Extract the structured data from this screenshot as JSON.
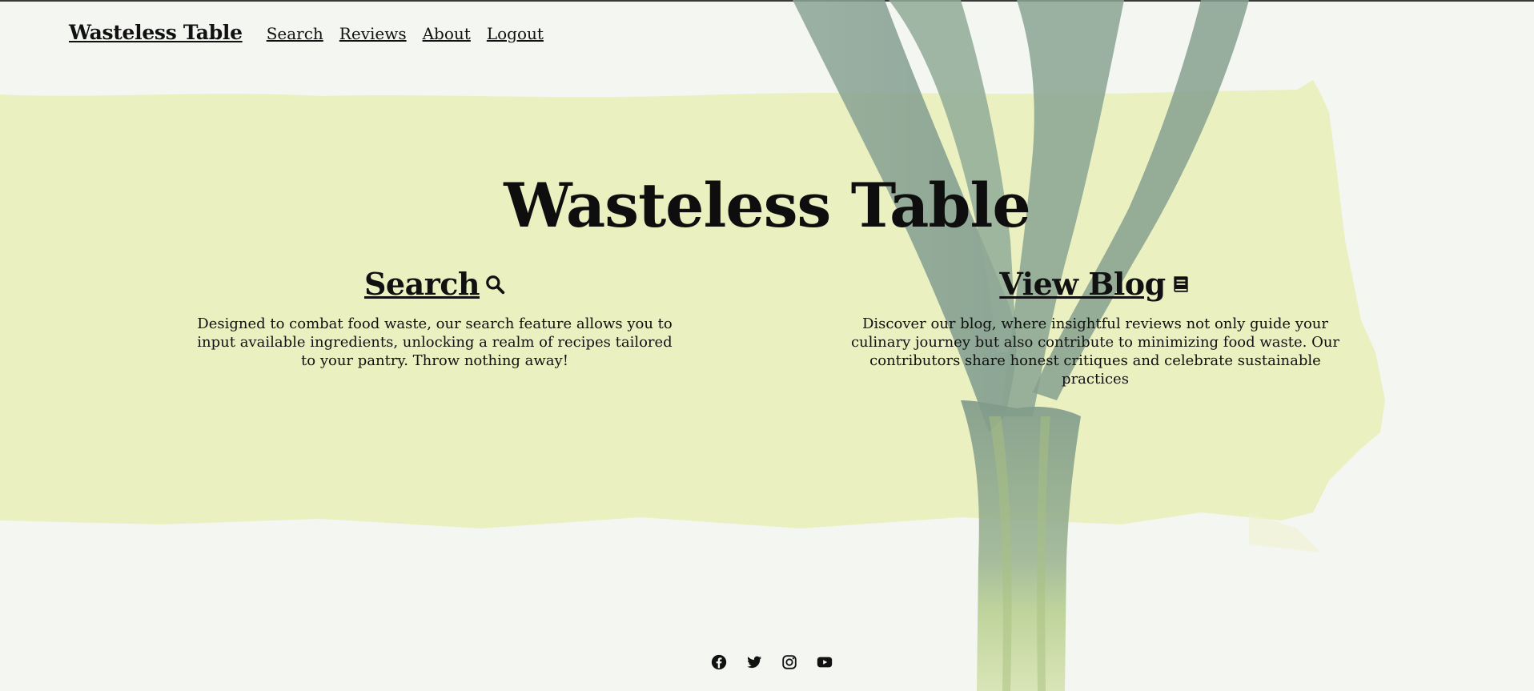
{
  "nav": {
    "brand": "Wasteless Table",
    "links": [
      "Search",
      "Reviews",
      "About",
      "Logout"
    ]
  },
  "hero": {
    "title": "Wasteless Table"
  },
  "sections": [
    {
      "heading": "Search",
      "icon": "search-icon",
      "text": "Designed to combat food waste, our search feature allows you to input available ingredients, unlocking a realm of recipes tailored to your pantry. Throw nothing away!"
    },
    {
      "heading": "View Blog",
      "icon": "book-icon",
      "text": "Discover our blog, where insightful reviews not only guide your culinary journey but also contribute to minimizing food waste. Our contributors share honest critiques and celebrate sustainable practices"
    }
  ],
  "footer": {
    "socials": [
      "facebook-icon",
      "twitter-icon",
      "instagram-icon",
      "youtube-icon"
    ]
  },
  "colors": {
    "background": "#f4f6f2",
    "brush": "#eaefbe",
    "leek_dark": "#8aa48e",
    "leek_light": "#c9dba5",
    "text": "#0e0e0e"
  }
}
